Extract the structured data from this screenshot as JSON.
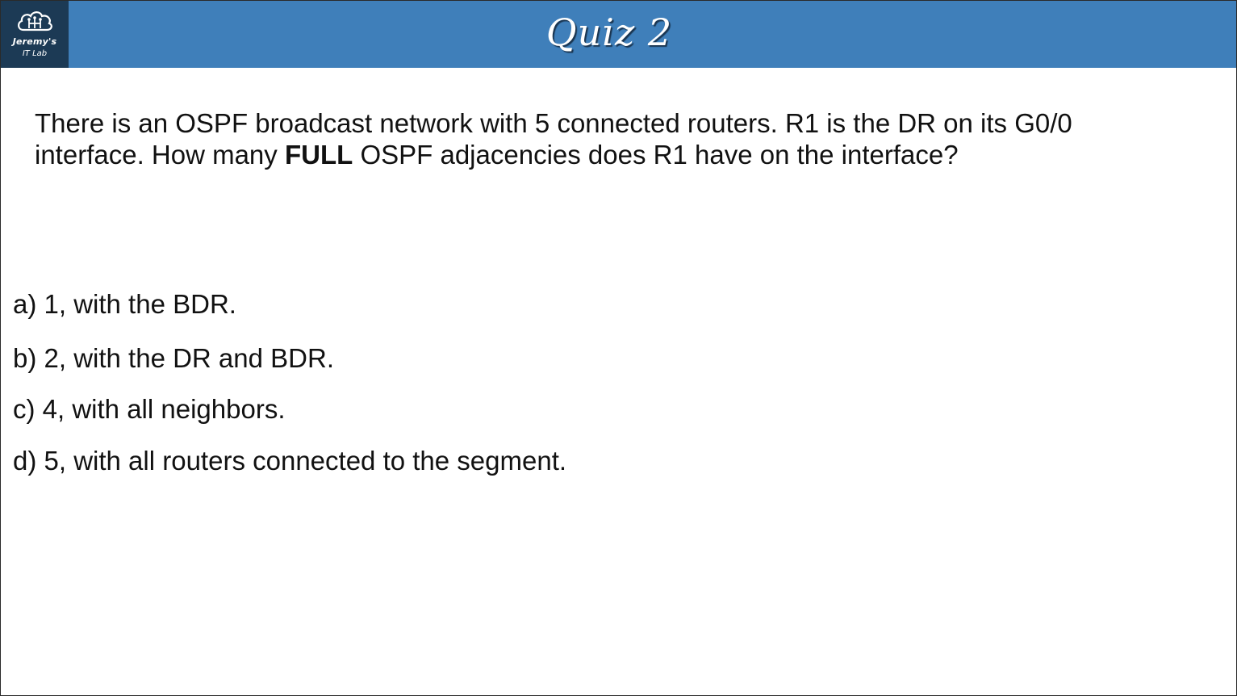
{
  "logo": {
    "icon": "cloud-circuit-icon",
    "line1": "Jeremy's",
    "line2": "IT Lab"
  },
  "title": "Quiz 2",
  "question": {
    "part1": "There is an OSPF broadcast network with 5 connected routers.  R1 is the DR on its G0/0 interface.  How many ",
    "emphasis": "FULL",
    "part2": " OSPF adjacencies does R1 have on the interface?"
  },
  "options": [
    "a) 1, with the BDR.",
    "b) 2, with the DR and BDR.",
    "c) 4, with all neighbors.",
    "d) 5, with all routers connected to the segment."
  ],
  "colors": {
    "header": "#3f7fba",
    "logo_bg": "#1c3a55",
    "text": "#111111"
  }
}
